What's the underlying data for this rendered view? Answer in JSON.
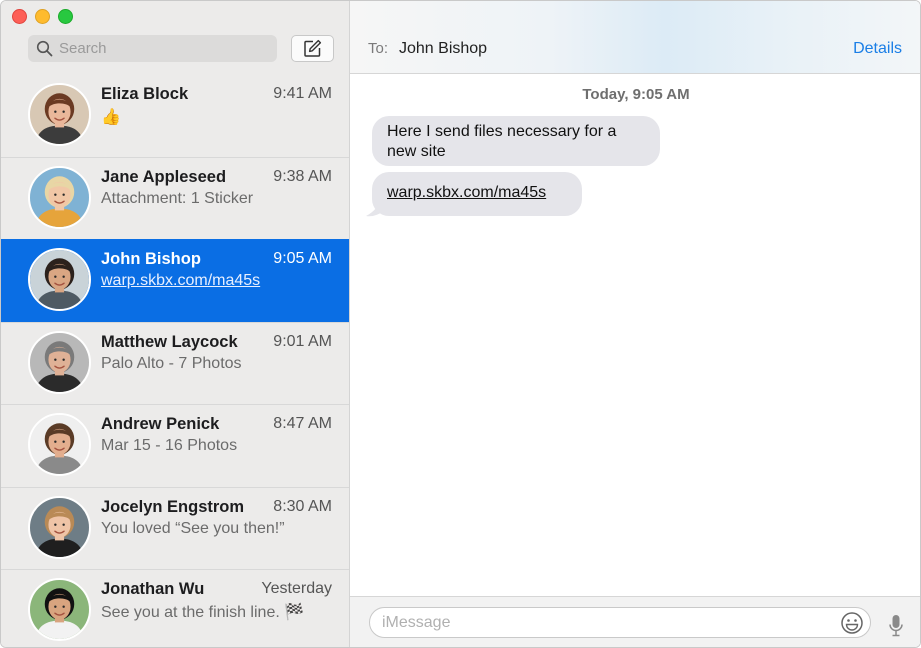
{
  "search": {
    "placeholder": "Search"
  },
  "conversations": [
    {
      "name": "Eliza Block",
      "time": "9:41 AM",
      "preview": "👍",
      "selected": false,
      "avatar": {
        "skin": "#e9b79a",
        "hair": "#6b3a22",
        "bg": "#d8c8b4",
        "shirt": "#3c3c3c"
      }
    },
    {
      "name": "Jane Appleseed",
      "time": "9:38 AM",
      "preview": "Attachment: 1 Sticker",
      "selected": false,
      "avatar": {
        "skin": "#f1c7a6",
        "hair": "#e8d6a5",
        "bg": "#7fb2d4",
        "shirt": "#e6a43b"
      }
    },
    {
      "name": "John Bishop",
      "time": "9:05 AM",
      "preview": "warp.skbx.com/ma45s",
      "selected": true,
      "avatar": {
        "skin": "#d9a683",
        "hair": "#2b211c",
        "bg": "#c9d3d8",
        "shirt": "#4e5a63"
      }
    },
    {
      "name": "Matthew Laycock",
      "time": "9:01 AM",
      "preview": "Palo Alto - 7 Photos",
      "selected": false,
      "avatar": {
        "skin": "#dfb196",
        "hair": "#7a7a7a",
        "bg": "#b8b8b8",
        "shirt": "#2b2b2b"
      }
    },
    {
      "name": "Andrew Penick",
      "time": "8:47 AM",
      "preview": "Mar 15 - 16 Photos",
      "selected": false,
      "avatar": {
        "skin": "#e3ae8e",
        "hair": "#5a3b26",
        "bg": "#efefef",
        "shirt": "#8a8a8a"
      }
    },
    {
      "name": "Jocelyn Engstrom",
      "time": "8:30 AM",
      "preview": "You loved “See you then!”",
      "selected": false,
      "avatar": {
        "skin": "#efc4a7",
        "hair": "#b98a56",
        "bg": "#6e7d86",
        "shirt": "#1f1f1f"
      }
    },
    {
      "name": "Jonathan Wu",
      "time": "Yesterday",
      "preview": "See you at the finish line. 🏁",
      "selected": false,
      "avatar": {
        "skin": "#d8a47f",
        "hair": "#111111",
        "bg": "#8bb67a",
        "shirt": "#f2f2f2"
      }
    }
  ],
  "header": {
    "to_label": "To:",
    "recipient": "John Bishop",
    "details_label": "Details"
  },
  "thread": {
    "timestamp": "Today, 9:05 AM",
    "messages": [
      {
        "text": "Here I send files necessary for a new site"
      },
      {
        "text": "warp.skbx.com/ma45s"
      }
    ]
  },
  "composer": {
    "placeholder": "iMessage"
  },
  "colors": {
    "selection": "#0a6ee4",
    "accent": "#1a7ee6",
    "bubble": "#e5e5ea"
  }
}
